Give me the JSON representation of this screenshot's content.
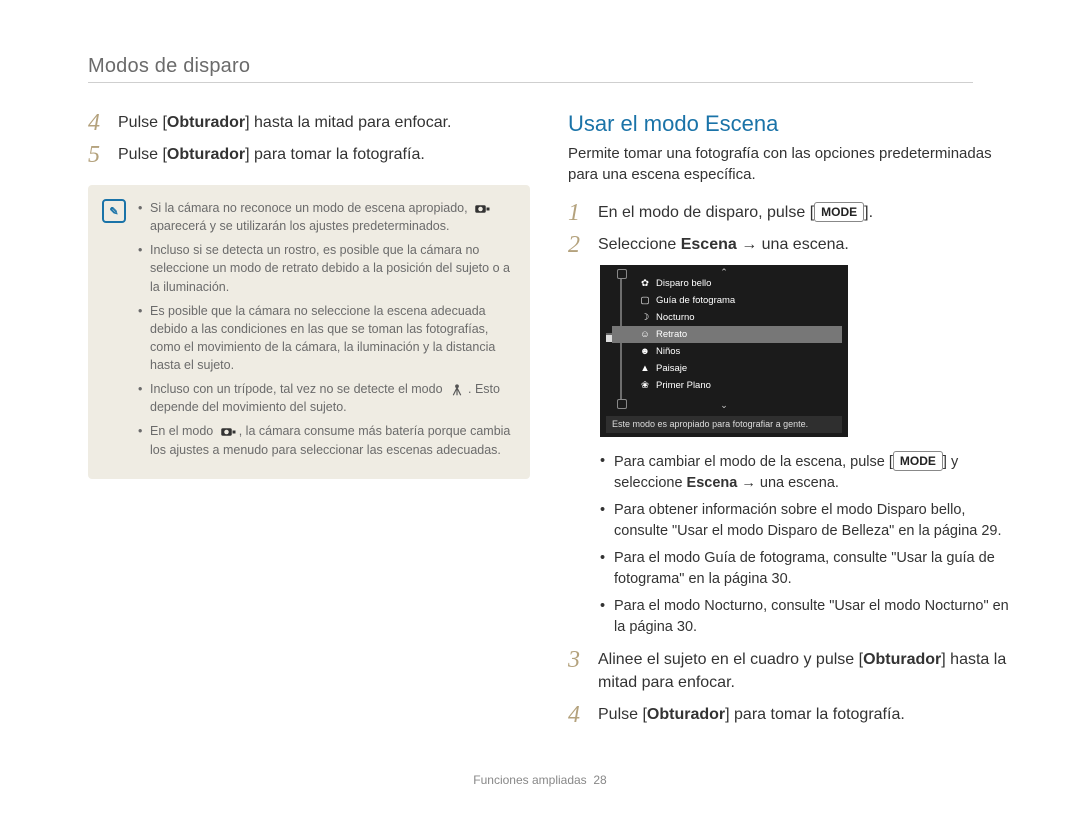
{
  "section_title": "Modos de disparo",
  "left": {
    "steps": [
      {
        "num": "4",
        "pre": "Pulse [",
        "bold": "Obturador",
        "post": "] hasta la mitad para enfocar."
      },
      {
        "num": "5",
        "pre": "Pulse [",
        "bold": "Obturador",
        "post": "] para tomar la fotografía."
      }
    ],
    "notes": [
      "Si la cámara no reconoce un modo de escena apropiado, ⟨smart-icon⟩ aparecerá y se utilizarán los ajustes predeterminados.",
      "Incluso si se detecta un rostro, es posible que la cámara no seleccione un modo de retrato debido a la posición del sujeto o a la iluminación.",
      "Es posible que la cámara no seleccione la escena adecuada debido a las condiciones en las que se toman las fotografías, como el movimiento de la cámara, la iluminación y la distancia hasta el sujeto.",
      "Incluso con un trípode, tal vez no se detecte el modo ⟨tripod-icon⟩. Esto depende del movimiento del sujeto.",
      "En el modo ⟨smart-icon⟩, la cámara consume más batería porque cambia los ajustes a menudo para seleccionar las escenas adecuadas."
    ]
  },
  "right": {
    "heading": "Usar el modo Escena",
    "intro": "Permite tomar una fotografía con las opciones predeterminadas para una escena específica.",
    "step1": {
      "num": "1",
      "pre": "En el modo de disparo, pulse [",
      "mode": "MODE",
      "post": "]."
    },
    "step2": {
      "num": "2",
      "pre": "Seleccione ",
      "bold": "Escena",
      "arrow": " → ",
      "post": "una escena."
    },
    "screen": {
      "items": [
        {
          "glyph": "✿",
          "label": "Disparo bello",
          "selected": false
        },
        {
          "glyph": "▢",
          "label": "Guía de fotograma",
          "selected": false
        },
        {
          "glyph": "☽",
          "label": "Nocturno",
          "selected": false
        },
        {
          "glyph": "☺",
          "label": "Retrato",
          "selected": true
        },
        {
          "glyph": "☻",
          "label": "Niños",
          "selected": false
        },
        {
          "glyph": "▲",
          "label": "Paisaje",
          "selected": false
        },
        {
          "glyph": "❀",
          "label": "Primer Plano",
          "selected": false
        }
      ],
      "desc": "Este modo es apropiado para fotografiar a gente."
    },
    "bullets": [
      {
        "pre": "Para cambiar el modo de la escena, pulse [",
        "mode": "MODE",
        "mid": "] y seleccione ",
        "bold": "Escena",
        "post": " → una escena."
      },
      {
        "text": "Para obtener información sobre el modo Disparo bello, consulte \"Usar el modo Disparo de Belleza\" en la página 29."
      },
      {
        "text": "Para el modo Guía de fotograma, consulte \"Usar la guía de fotograma\" en la página 30."
      },
      {
        "text": "Para el modo Nocturno, consulte \"Usar el modo Nocturno\" en la página 30."
      }
    ],
    "step3": {
      "num": "3",
      "pre": "Alinee el sujeto en el cuadro y pulse [",
      "bold": "Obturador",
      "post": "] hasta la mitad para enfocar."
    },
    "step4": {
      "num": "4",
      "pre": "Pulse [",
      "bold": "Obturador",
      "post": "] para tomar la fotografía."
    }
  },
  "footer": {
    "label": "Funciones ampliadas",
    "page": "28"
  }
}
